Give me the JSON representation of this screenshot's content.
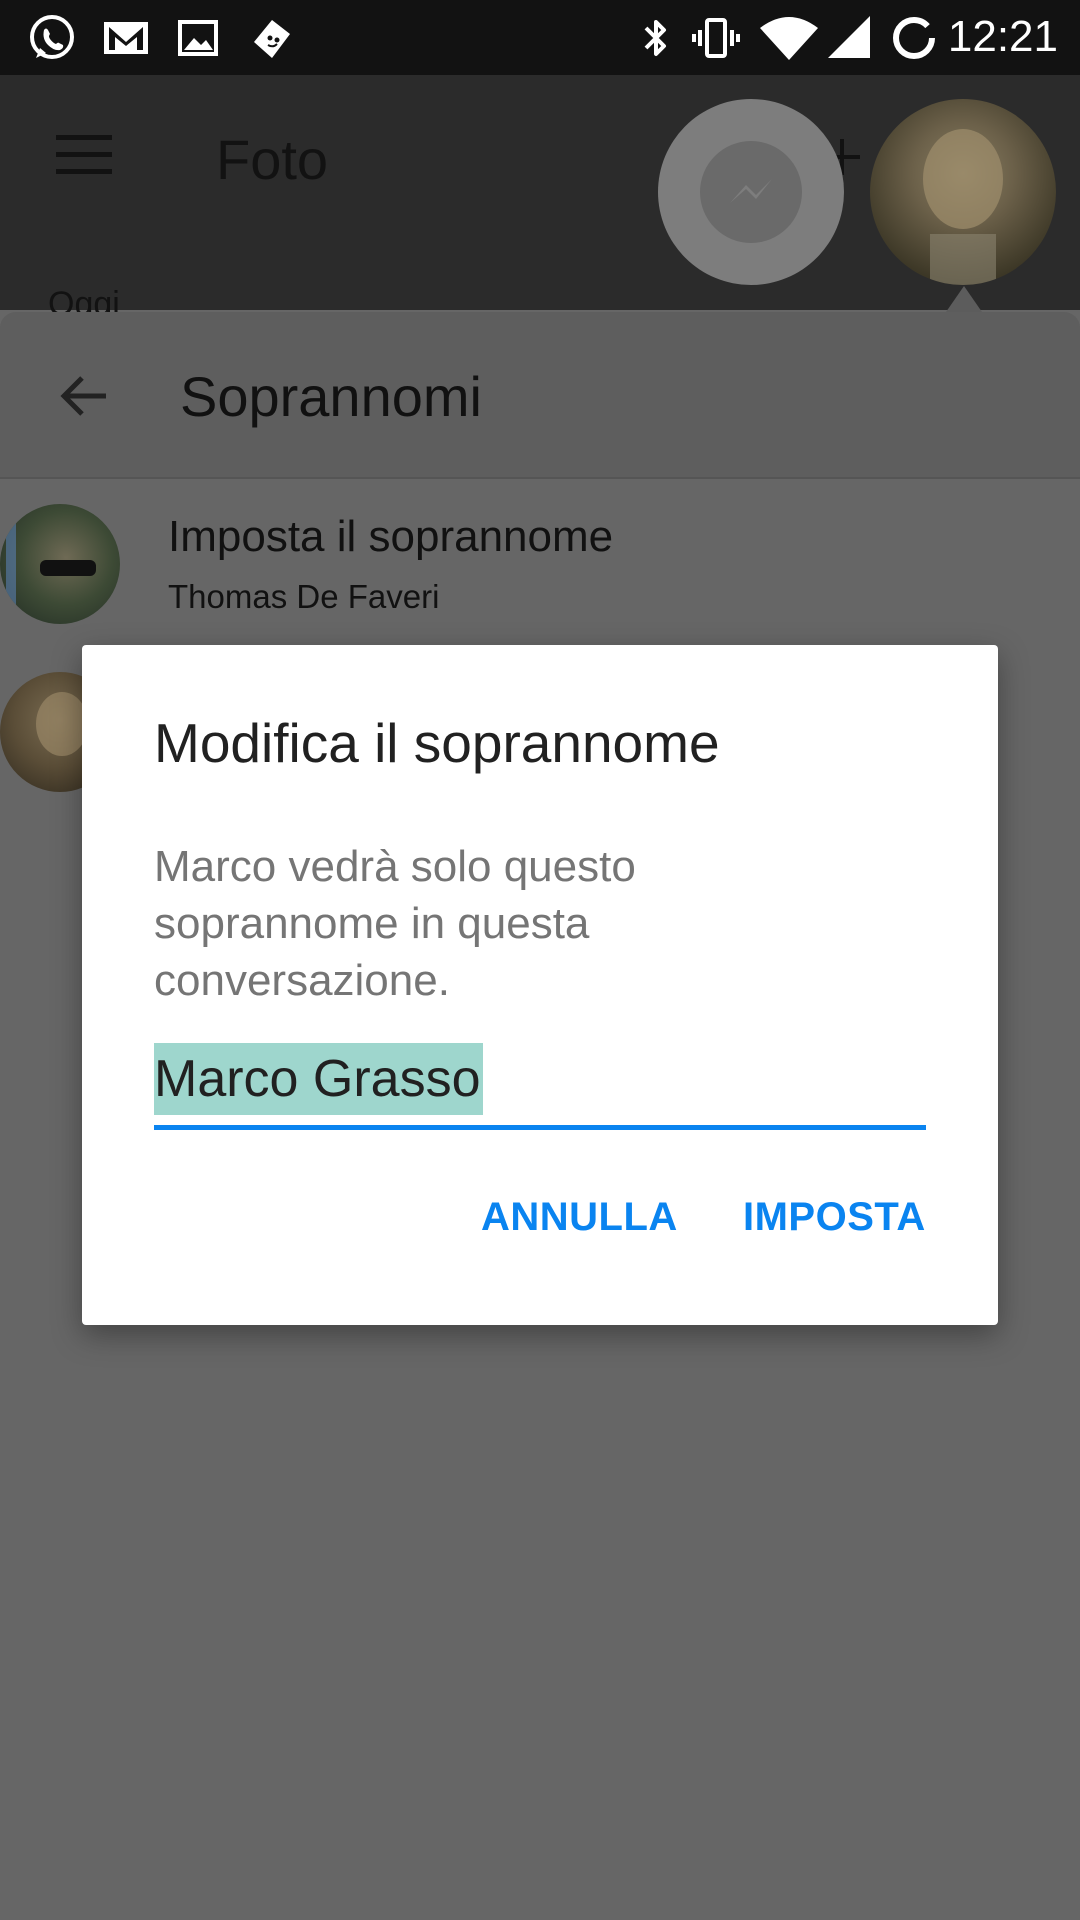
{
  "status_bar": {
    "time": "12:21",
    "left_icons": [
      "whatsapp-icon",
      "gmail-icon",
      "gallery-icon",
      "app-notification-icon"
    ],
    "right_icons": [
      "bluetooth-icon",
      "vibrate-icon",
      "wifi-icon",
      "cell-signal-icon",
      "battery-charging-icon"
    ]
  },
  "app_bar": {
    "title": "Foto",
    "subtitle": "Oggi"
  },
  "sheet": {
    "title": "Soprannomi",
    "rows": [
      {
        "title": "Imposta il soprannome",
        "subtitle": "Thomas De Faveri"
      }
    ]
  },
  "dialog": {
    "title": "Modifica il soprannome",
    "message": "Marco vedrà solo questo soprannome in questa conversazione.",
    "nickname_value": "Marco Grasso",
    "cancel_label": "ANNULLA",
    "confirm_label": "IMPOSTA"
  },
  "colors": {
    "accent": "#0a84f0",
    "selection": "#9ed6cd",
    "scrim": "#666666"
  }
}
